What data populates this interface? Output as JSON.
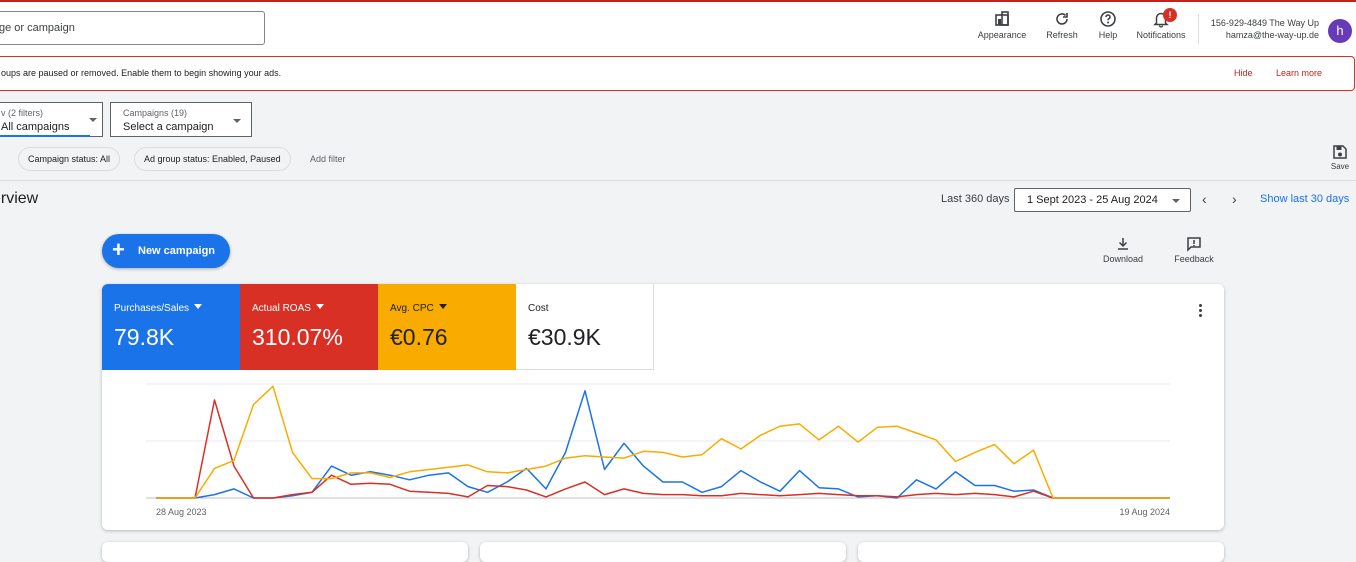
{
  "header": {
    "search_placeholder": "ge or campaign",
    "tools": {
      "appearance": "Appearance",
      "refresh": "Refresh",
      "help": "Help",
      "notifications": "Notifications",
      "notification_badge": "!"
    },
    "account_line1": "156-929-4849 The Way Up",
    "account_line2": "hamza@the-way-up.de",
    "avatar_letter": "h"
  },
  "alert": {
    "message": "oups are paused or removed. Enable them to begin showing your ads.",
    "hide": "Hide",
    "learn_more": "Learn more"
  },
  "filters": {
    "view_small": "v (2 filters)",
    "view_value": "All campaigns",
    "campaigns_small": "Campaigns (19)",
    "campaigns_value": "Select a campaign",
    "chips": [
      "Campaign status: All",
      "Ad group status: Enabled, Paused"
    ],
    "add_filter": "Add filter",
    "save": "Save"
  },
  "overview": {
    "title": "erview",
    "last_days": "Last 360 days",
    "date_range": "1 Sept 2023 - 25 Aug 2024",
    "show_last": "Show last 30 days",
    "new_campaign": "New campaign",
    "download": "Download",
    "feedback": "Feedback"
  },
  "metrics": [
    {
      "label": "Purchases/Sales",
      "value": "79.8K",
      "color": "#1a73e8",
      "dropdown": true
    },
    {
      "label": "Actual ROAS",
      "value": "310.07%",
      "color": "#d93025",
      "dropdown": true
    },
    {
      "label": "Avg. CPC",
      "value": "€0.76",
      "color": "#f9ab00",
      "dropdown": true
    },
    {
      "label": "Cost",
      "value": "€30.9K",
      "color": "#ffffff",
      "dropdown": false
    }
  ],
  "chart_data": {
    "type": "line",
    "x_start_label": "28 Aug 2023",
    "x_end_label": "19 Aug 2024",
    "grid": true,
    "y_normalized": true,
    "series": [
      {
        "color": "#1a73e8",
        "values": [
          0,
          0,
          0,
          0.03,
          0.08,
          0,
          0,
          0.02,
          0.05,
          0.28,
          0.2,
          0.23,
          0.2,
          0.16,
          0.2,
          0.22,
          0.1,
          0.05,
          0.14,
          0.26,
          0.08,
          0.4,
          0.94,
          0.25,
          0.48,
          0.28,
          0.14,
          0.14,
          0.05,
          0.1,
          0.24,
          0.14,
          0.06,
          0.24,
          0.09,
          0.08,
          0.01,
          0.02,
          0,
          0.16,
          0.08,
          0.23,
          0.11,
          0.11,
          0.06,
          0.07,
          0,
          0,
          0,
          0,
          0,
          0,
          0
        ]
      },
      {
        "color": "#d93025",
        "values": [
          0,
          0,
          0,
          0.86,
          0.28,
          0,
          0,
          0.03,
          0.05,
          0.2,
          0.12,
          0.13,
          0.12,
          0.06,
          0.05,
          0.04,
          0.01,
          0.11,
          0.1,
          0.07,
          0.01,
          0.08,
          0.14,
          0.03,
          0.08,
          0.04,
          0.03,
          0.03,
          0.02,
          0.02,
          0.04,
          0.03,
          0.02,
          0.03,
          0.04,
          0.03,
          0.02,
          0.02,
          0.01,
          0.03,
          0.04,
          0.03,
          0.04,
          0.03,
          0.01,
          0.06,
          0,
          0,
          0,
          0,
          0,
          0,
          0
        ]
      },
      {
        "color": "#f9ab00",
        "values": [
          0,
          0,
          0,
          0.26,
          0.33,
          0.82,
          0.98,
          0.4,
          0.17,
          0.17,
          0.22,
          0.22,
          0.18,
          0.23,
          0.25,
          0.27,
          0.29,
          0.23,
          0.22,
          0.25,
          0.28,
          0.35,
          0.37,
          0.36,
          0.35,
          0.41,
          0.4,
          0.36,
          0.38,
          0.52,
          0.43,
          0.55,
          0.63,
          0.65,
          0.51,
          0.63,
          0.49,
          0.62,
          0.63,
          0.57,
          0.51,
          0.32,
          0.4,
          0.47,
          0.3,
          0.42,
          0,
          0,
          0,
          0,
          0,
          0,
          0
        ]
      }
    ]
  }
}
